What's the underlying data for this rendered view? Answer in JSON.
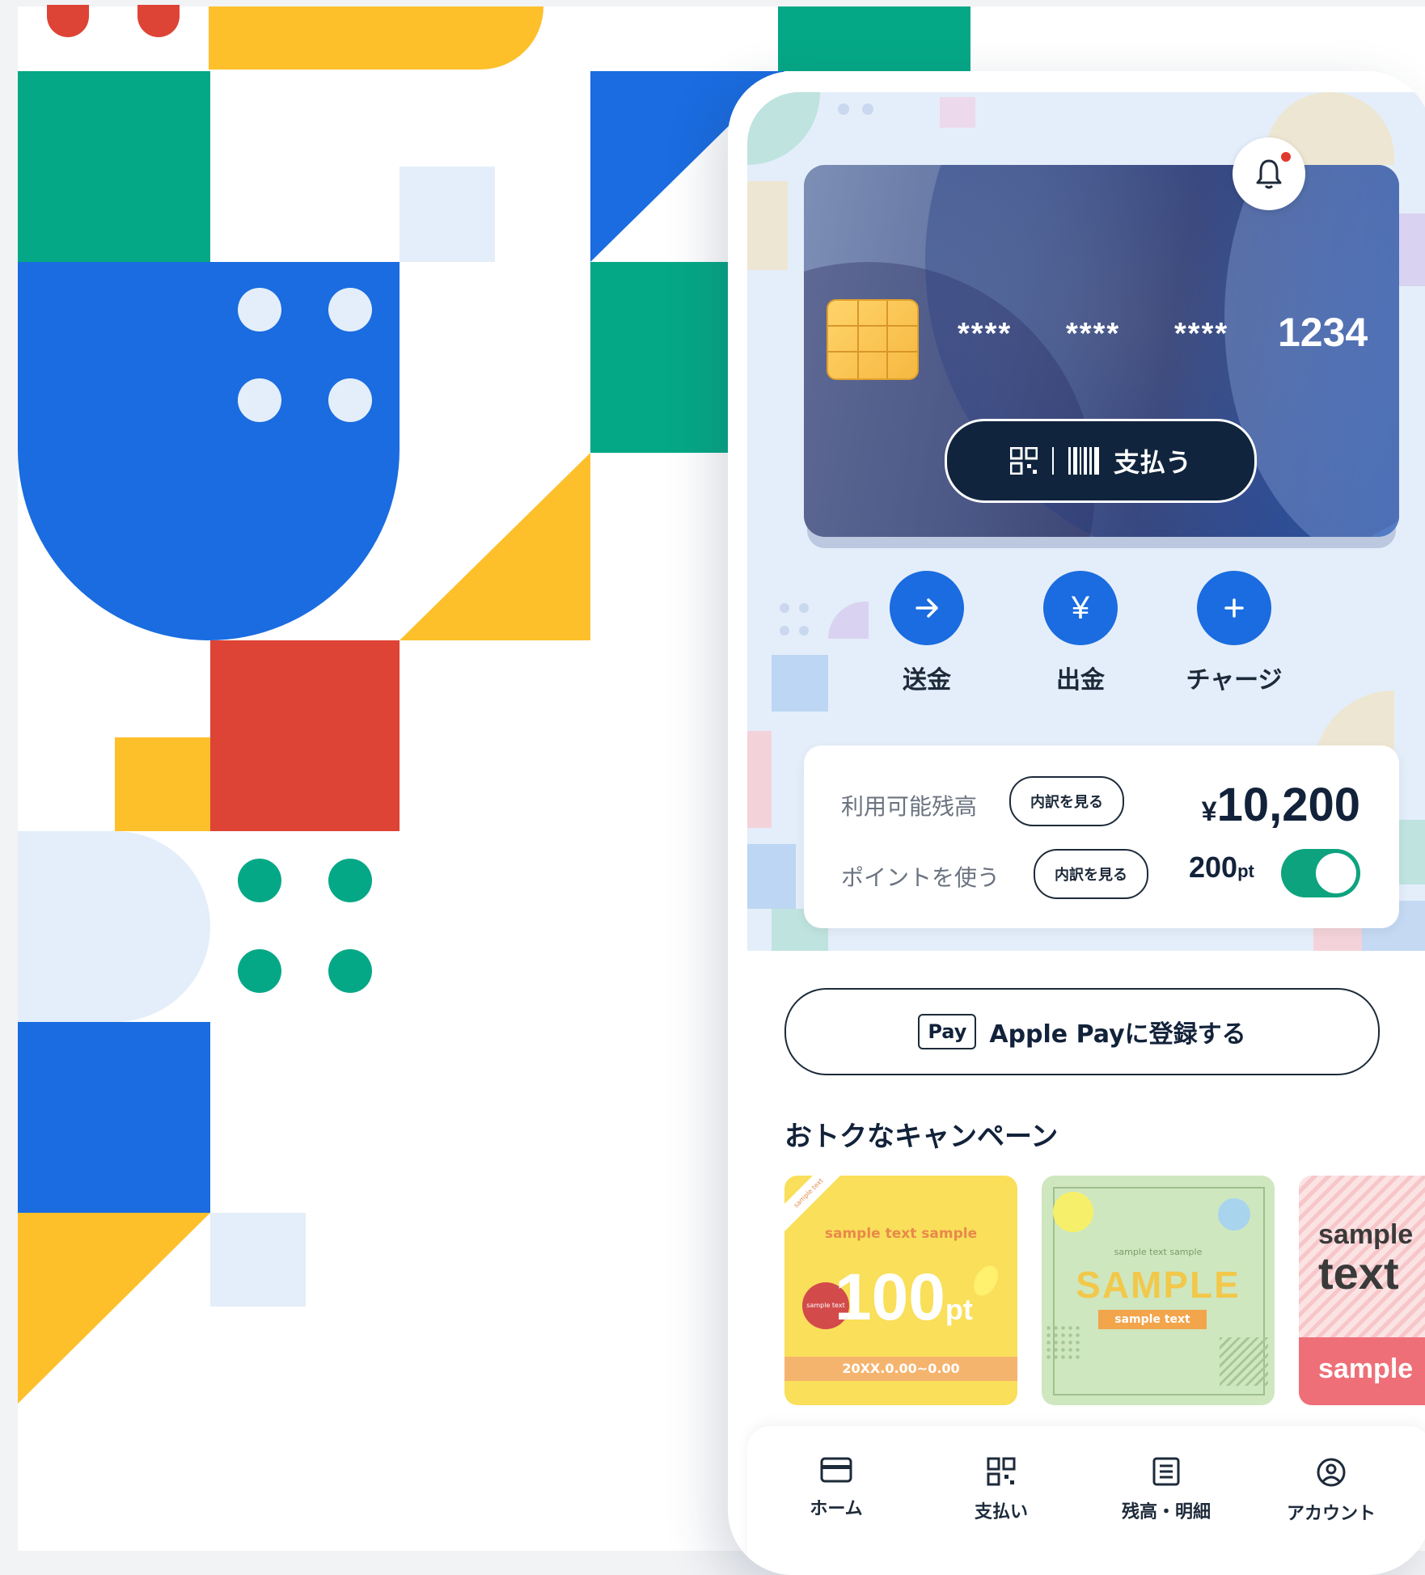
{
  "card": {
    "masked_group_1": "****",
    "masked_group_2": "****",
    "masked_group_3": "****",
    "last_four": "1234",
    "pay_button_label": "支払う"
  },
  "actions": {
    "send_label": "送金",
    "send_icon": "arrow-right-icon",
    "withdraw_label": "出金",
    "withdraw_icon": "yen-icon",
    "charge_label": "チャージ",
    "charge_icon": "plus-icon"
  },
  "balance": {
    "available_label": "利用可能残高",
    "breakdown_label": "内訳を見る",
    "currency_symbol": "¥",
    "amount": "10,200",
    "use_points_label": "ポイントを使う",
    "points_breakdown_label": "内訳を見る",
    "points_value": "200",
    "points_unit": "pt",
    "use_points_enabled": true
  },
  "apple_pay": {
    "badge": "Pay",
    "label": "Apple Payに登録する"
  },
  "campaigns": {
    "title": "おトクなキャンペーン",
    "items": [
      {
        "corner": "sample text",
        "heading": "sample text sample",
        "value": "100",
        "unit": "pt",
        "seal": "sample text",
        "period": "20XX.0.00~0.00"
      },
      {
        "arc": "sample text sample",
        "heading": "SAMPLE",
        "sub": "sample text"
      },
      {
        "line1": "sample",
        "line2": "text",
        "line3": "sample"
      }
    ]
  },
  "nav": {
    "home": "ホーム",
    "pay": "支払い",
    "statement": "残高・明細",
    "account": "アカウント"
  },
  "colors": {
    "accent_blue": "#1a6ce0",
    "toggle_green": "#0da37f",
    "dark_navy": "#10243d"
  }
}
